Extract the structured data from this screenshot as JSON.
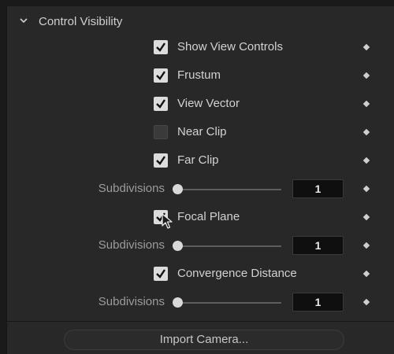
{
  "section": {
    "title": "Control Visibility",
    "toggle_icon": "chevron-down-icon"
  },
  "rows": [
    {
      "type": "checkbox",
      "label": "Show View Controls",
      "checked": true
    },
    {
      "type": "checkbox",
      "label": "Frustum",
      "checked": true
    },
    {
      "type": "checkbox",
      "label": "View Vector",
      "checked": true
    },
    {
      "type": "checkbox",
      "label": "Near Clip",
      "checked": false
    },
    {
      "type": "checkbox",
      "label": "Far Clip",
      "checked": true
    },
    {
      "type": "slider",
      "label": "Subdivisions",
      "value": "1"
    },
    {
      "type": "checkbox",
      "label": "Focal Plane",
      "checked": true
    },
    {
      "type": "slider",
      "label": "Subdivisions",
      "value": "1"
    },
    {
      "type": "checkbox",
      "label": "Convergence Distance",
      "checked": true
    },
    {
      "type": "slider",
      "label": "Subdivisions",
      "value": "1"
    }
  ],
  "import_button": {
    "label": "Import Camera..."
  },
  "colors": {
    "panel_bg": "#282829",
    "check_bg": "#dcdcdc",
    "field_bg": "#0f0f0f"
  },
  "icons": {
    "keyframe": "keyframe-diamond-icon",
    "check": "checkmark-icon",
    "cursor": "mouse-pointer-icon"
  }
}
